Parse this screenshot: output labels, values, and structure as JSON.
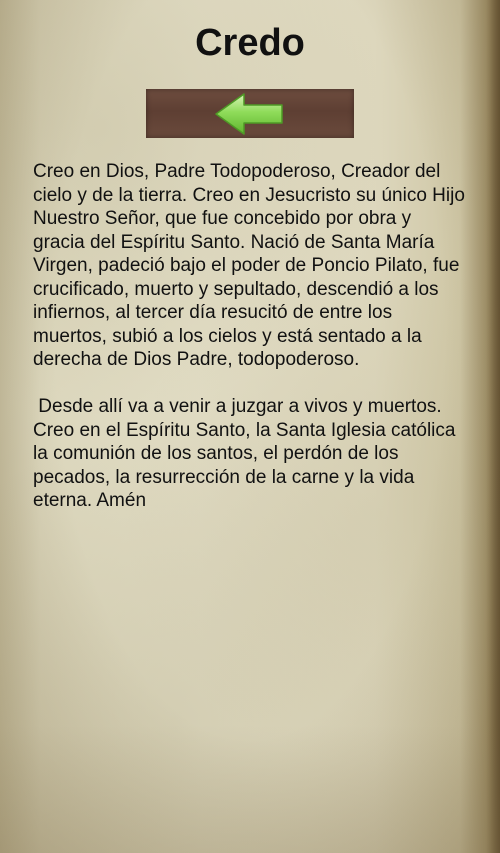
{
  "header": {
    "title": "Credo"
  },
  "toolbar": {
    "back_icon": "left-arrow-icon",
    "accent_color": "#7fcf4a"
  },
  "content": {
    "paragraphs": [
      "Creo en Dios, Padre Todopoderoso, Creador del cielo y de la tierra. Creo en Jesucristo su único Hijo Nuestro Señor, que fue concebido por obra y gracia del Espíritu Santo. Nació de Santa María Virgen, padeció bajo el poder de Poncio Pilato, fue crucificado, muerto y sepultado, descendió a los infiernos, al tercer día resucitó de entre los muertos, subió a los cielos y está sentado a la derecha de Dios Padre, todopoderoso.",
      " Desde allí va a venir a juzgar a vivos y muertos. Creo en el Espíritu Santo, la Santa Iglesia católica la comunión de los santos, el perdón de los pecados, la resurrección de la carne y la vida eterna. Amén"
    ]
  }
}
